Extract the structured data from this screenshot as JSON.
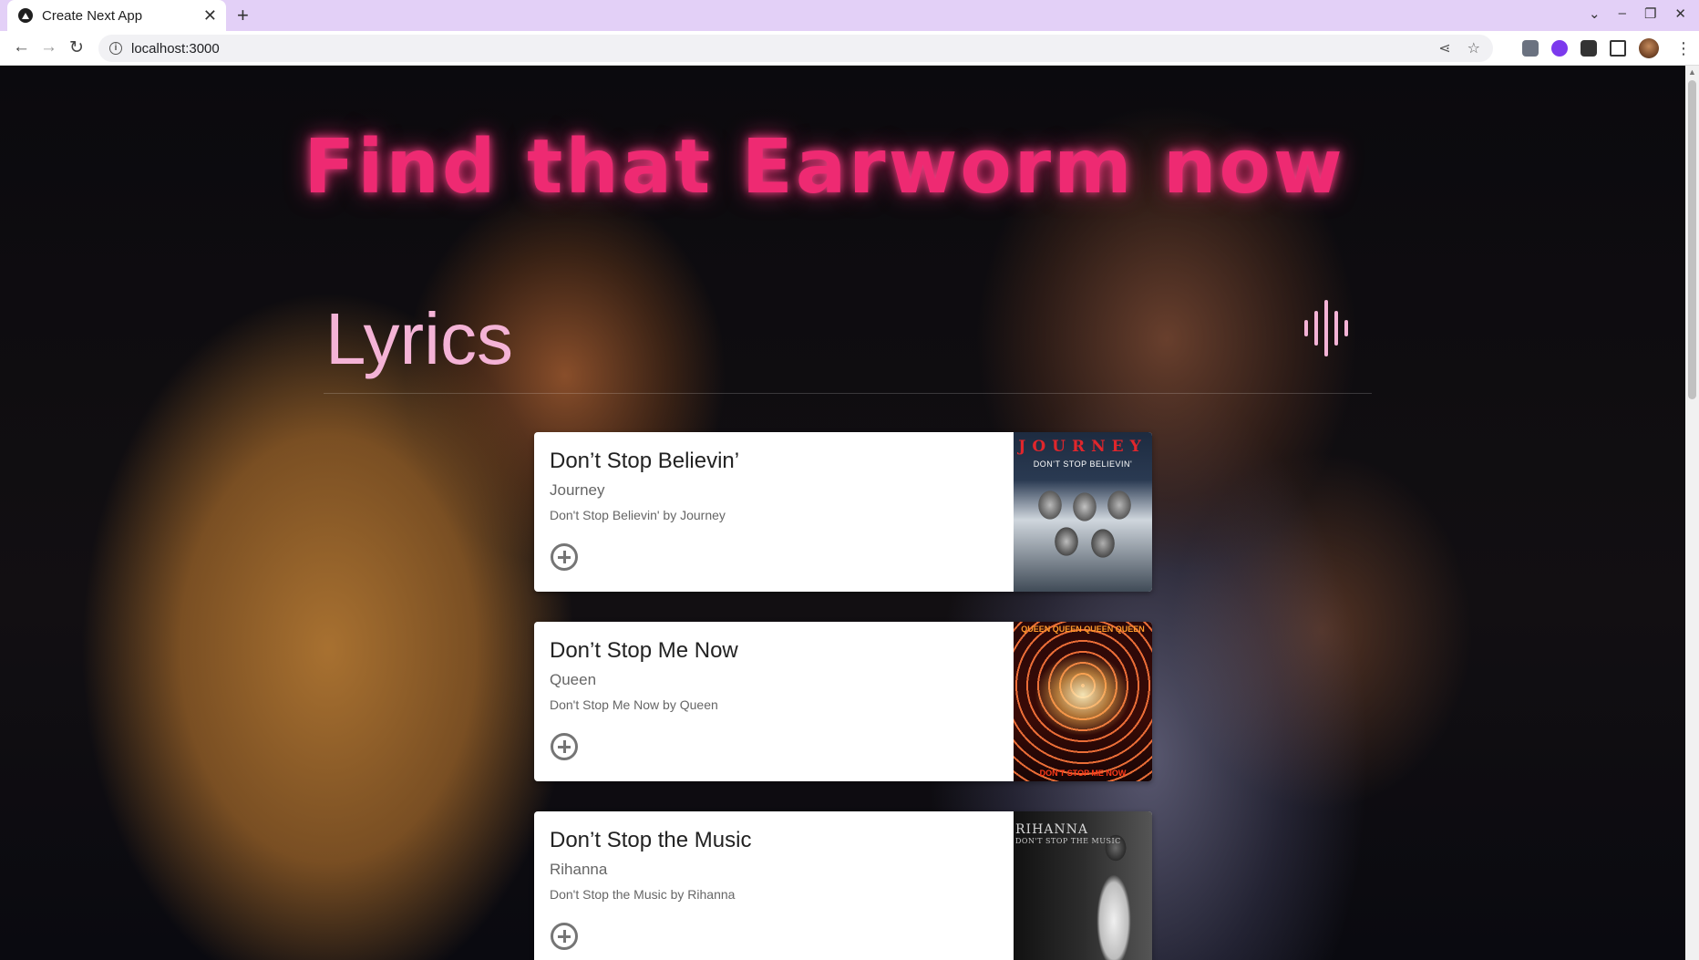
{
  "browser": {
    "tab_title": "Create Next App",
    "new_tab_label": "+",
    "url": "localhost:3000"
  },
  "page": {
    "headline": "Find that Earworm now",
    "search_label": "Lyrics",
    "colors": {
      "headline": "#ee2a72",
      "label": "#f4b3d6",
      "card_bg": "#ffffff"
    }
  },
  "results": [
    {
      "title": "Don’t Stop Believin’",
      "artist": "Journey",
      "description": "Don't Stop Believin' by Journey",
      "cover": {
        "brand": "JOURNEY",
        "sub": "DON'T STOP BELIEVIN'"
      }
    },
    {
      "title": "Don’t Stop Me Now",
      "artist": "Queen",
      "description": "Don't Stop Me Now by Queen",
      "cover": {
        "band": "QUEEN QUEEN QUEEN QUEEN",
        "foot": "DON'T STOP ME NOW"
      }
    },
    {
      "title": "Don’t Stop the Music",
      "artist": "Rihanna",
      "description": "Don't Stop the Music by Rihanna",
      "cover": {
        "name": "RIHANNA",
        "sub": "DON'T STOP THE MUSIC"
      }
    }
  ]
}
